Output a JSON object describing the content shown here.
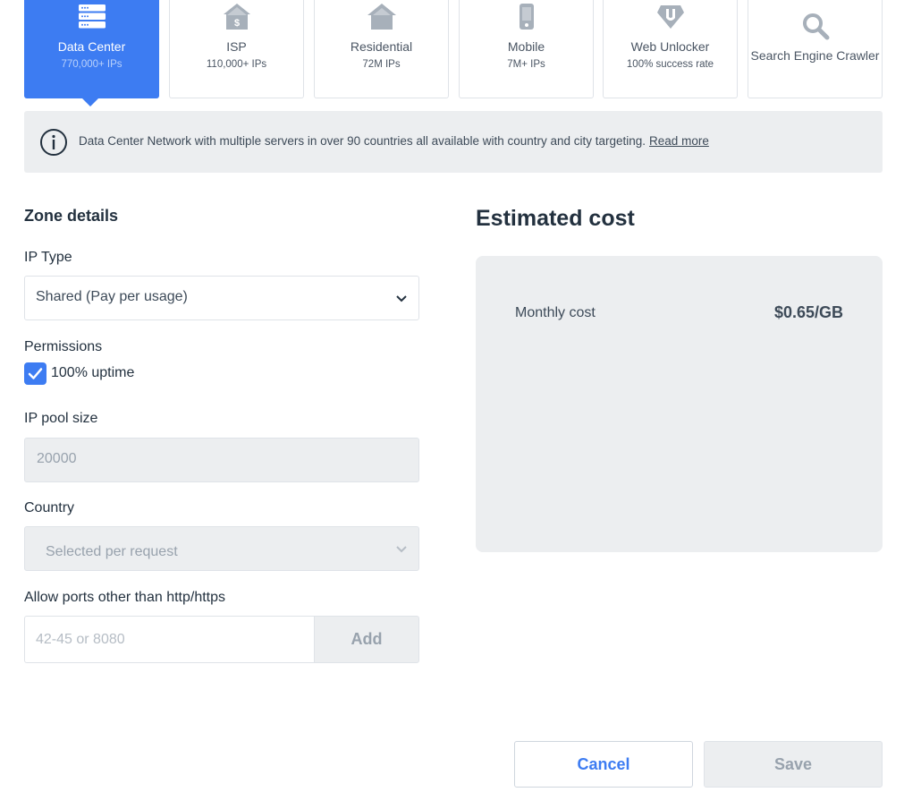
{
  "tabs": [
    {
      "name": "Data Center",
      "sub": "770,000+ IPs",
      "icon": "server-icon",
      "active": true
    },
    {
      "name": "ISP",
      "sub": "110,000+ IPs",
      "icon": "isp-house-icon"
    },
    {
      "name": "Residential",
      "sub": "72M IPs",
      "icon": "house-icon"
    },
    {
      "name": "Mobile",
      "sub": "7M+ IPs",
      "icon": "mobile-icon"
    },
    {
      "name": "Web Unlocker",
      "sub": "100% success rate",
      "icon": "unlocker-icon"
    },
    {
      "name": "Search Engine Crawler",
      "sub": "",
      "icon": "search-icon"
    }
  ],
  "banner": {
    "text": "Data Center Network with multiple servers in over 90 countries all available with country and city targeting.",
    "link": "Read more"
  },
  "zone": {
    "title": "Zone details",
    "ip_type_label": "IP Type",
    "ip_type_value": "Shared (Pay per usage)",
    "permissions_label": "Permissions",
    "uptime_label": "100% uptime",
    "uptime_checked": true,
    "pool_label": "IP pool size",
    "pool_value": "20000",
    "country_label": "Country",
    "country_value": "Selected per request",
    "ports_label": "Allow ports other than http/https",
    "ports_placeholder": "42-45 or 8080",
    "add_label": "Add"
  },
  "cost": {
    "title": "Estimated cost",
    "monthly_label": "Monthly cost",
    "monthly_value": "$0.65/GB"
  },
  "footer": {
    "cancel": "Cancel",
    "save": "Save"
  },
  "colors": {
    "accent": "#3d7cf2",
    "panel": "#eceef0",
    "text": "#23313f"
  }
}
